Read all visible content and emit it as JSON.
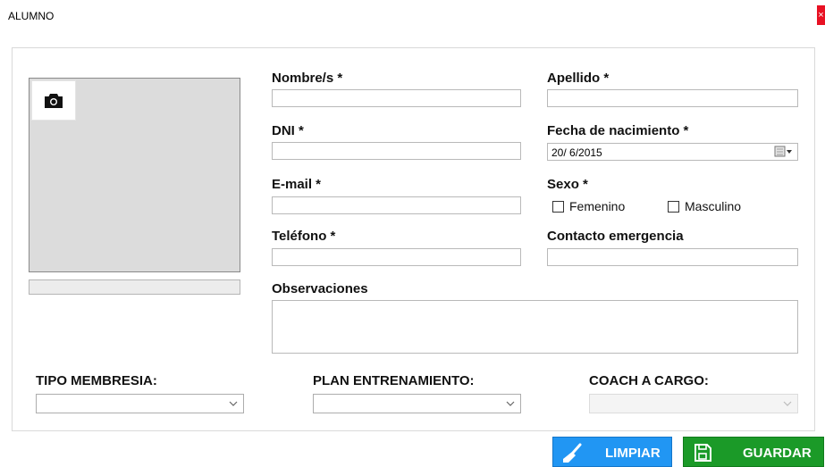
{
  "window": {
    "title": "ALUMNO",
    "close_glyph": "×"
  },
  "form": {
    "nombre_label": "Nombre/s *",
    "nombre_value": "",
    "apellido_label": "Apellido *",
    "apellido_value": "",
    "dni_label": "DNI *",
    "dni_value": "",
    "fecha_label": "Fecha de nacimiento *",
    "fecha_value": "20/ 6/2015",
    "email_label": "E-mail *",
    "email_value": "",
    "sexo_label": "Sexo *",
    "sexo_options": [
      "Femenino",
      "Masculino"
    ],
    "telefono_label": "Teléfono *",
    "telefono_value": "",
    "contacto_label": "Contacto emergencia",
    "contacto_value": "",
    "observaciones_label": "Observaciones",
    "observaciones_value": ""
  },
  "bottom": {
    "tipo_membresia_label": "TIPO MEMBRESIA:",
    "plan_entrenamiento_label": "PLAN ENTRENAMIENTO:",
    "coach_label": "COACH A CARGO:"
  },
  "buttons": {
    "limpiar": "LIMPIAR",
    "guardar": "GUARDAR"
  },
  "icons": {
    "camera": "camera-icon",
    "broom": "broom-icon",
    "save": "save-icon",
    "calendar": "calendar-icon",
    "dropdown": "chevron-down-icon"
  },
  "colors": {
    "limpiar_bg": "#2196f3",
    "guardar_bg": "#1b9a28",
    "close_bg": "#e81123",
    "photo_bg": "#dcdcdc"
  }
}
